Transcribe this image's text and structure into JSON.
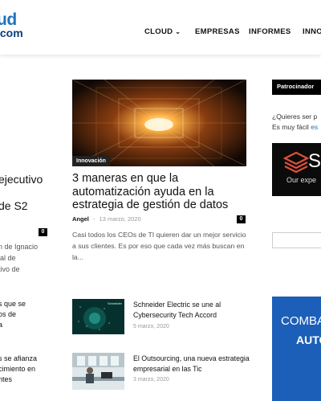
{
  "header": {
    "logo_top": "ud",
    "logo_bottom": ".com",
    "nav": [
      {
        "label": "CLOUD",
        "has_dropdown": true
      },
      {
        "label": "EMPRESAS",
        "has_dropdown": false
      },
      {
        "label": "INFORMES",
        "has_dropdown": false
      },
      {
        "label": "INNO",
        "has_dropdown": false
      }
    ],
    "chevron": "⌄"
  },
  "left_column": {
    "title_lines": [
      "ejecutivo",
      "de S2"
    ],
    "comment_count": "0",
    "excerpt_lines": [
      "n de Ignacio",
      "ial de",
      "tivo de"
    ],
    "item1_lines": [
      "s que se",
      "os de",
      "a"
    ],
    "item2_lines": [
      "s se afianza",
      "cimiento en",
      "ntes"
    ]
  },
  "featured": {
    "category": "Innovación",
    "title": "3 maneras en que la automatización ayuda en la estrategia de gestión de datos",
    "author": "Angel",
    "separator": "-",
    "date": "13 marzo, 2020",
    "comment_count": "0",
    "excerpt": "Casi todos los CEOs de TI quieren dar un mejor servicio a sus clientes. Es por eso que cada vez más buscan en la..."
  },
  "list": [
    {
      "title": "Schneider Electric se une al Cybersecurity Tech Accord",
      "date": "5 marzo, 2020",
      "thumb_brand": "Schneider"
    },
    {
      "title": "El Outsourcing, una nueva estrategia empresarial en las Tic",
      "date": "3 marzo, 2020"
    }
  ],
  "sidebar": {
    "header": "Patrocinador",
    "line1": "¿Quieres ser p",
    "line2_prefix": "Es muy fácil ",
    "line2_link": "es",
    "ad1_letter": "S",
    "ad1_tagline": "Our expe",
    "ad2_line1": "COMBAT",
    "ad2_line2": "AUTO"
  },
  "colors": {
    "brand_blue": "#1e73be",
    "brand_dark_blue": "#0a3e7a",
    "ad_blue": "#1c5fb8",
    "ad_orange": "#e0503a"
  }
}
